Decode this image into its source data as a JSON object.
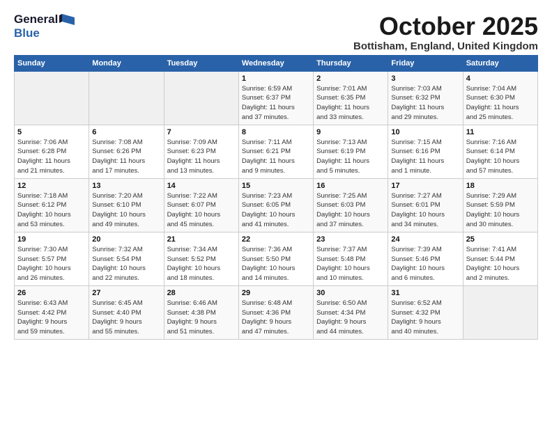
{
  "logo": {
    "general": "General",
    "blue": "Blue"
  },
  "title": "October 2025",
  "location": "Bottisham, England, United Kingdom",
  "weekdays": [
    "Sunday",
    "Monday",
    "Tuesday",
    "Wednesday",
    "Thursday",
    "Friday",
    "Saturday"
  ],
  "weeks": [
    [
      {
        "day": "",
        "info": ""
      },
      {
        "day": "",
        "info": ""
      },
      {
        "day": "",
        "info": ""
      },
      {
        "day": "1",
        "info": "Sunrise: 6:59 AM\nSunset: 6:37 PM\nDaylight: 11 hours\nand 37 minutes."
      },
      {
        "day": "2",
        "info": "Sunrise: 7:01 AM\nSunset: 6:35 PM\nDaylight: 11 hours\nand 33 minutes."
      },
      {
        "day": "3",
        "info": "Sunrise: 7:03 AM\nSunset: 6:32 PM\nDaylight: 11 hours\nand 29 minutes."
      },
      {
        "day": "4",
        "info": "Sunrise: 7:04 AM\nSunset: 6:30 PM\nDaylight: 11 hours\nand 25 minutes."
      }
    ],
    [
      {
        "day": "5",
        "info": "Sunrise: 7:06 AM\nSunset: 6:28 PM\nDaylight: 11 hours\nand 21 minutes."
      },
      {
        "day": "6",
        "info": "Sunrise: 7:08 AM\nSunset: 6:26 PM\nDaylight: 11 hours\nand 17 minutes."
      },
      {
        "day": "7",
        "info": "Sunrise: 7:09 AM\nSunset: 6:23 PM\nDaylight: 11 hours\nand 13 minutes."
      },
      {
        "day": "8",
        "info": "Sunrise: 7:11 AM\nSunset: 6:21 PM\nDaylight: 11 hours\nand 9 minutes."
      },
      {
        "day": "9",
        "info": "Sunrise: 7:13 AM\nSunset: 6:19 PM\nDaylight: 11 hours\nand 5 minutes."
      },
      {
        "day": "10",
        "info": "Sunrise: 7:15 AM\nSunset: 6:16 PM\nDaylight: 11 hours\nand 1 minute."
      },
      {
        "day": "11",
        "info": "Sunrise: 7:16 AM\nSunset: 6:14 PM\nDaylight: 10 hours\nand 57 minutes."
      }
    ],
    [
      {
        "day": "12",
        "info": "Sunrise: 7:18 AM\nSunset: 6:12 PM\nDaylight: 10 hours\nand 53 minutes."
      },
      {
        "day": "13",
        "info": "Sunrise: 7:20 AM\nSunset: 6:10 PM\nDaylight: 10 hours\nand 49 minutes."
      },
      {
        "day": "14",
        "info": "Sunrise: 7:22 AM\nSunset: 6:07 PM\nDaylight: 10 hours\nand 45 minutes."
      },
      {
        "day": "15",
        "info": "Sunrise: 7:23 AM\nSunset: 6:05 PM\nDaylight: 10 hours\nand 41 minutes."
      },
      {
        "day": "16",
        "info": "Sunrise: 7:25 AM\nSunset: 6:03 PM\nDaylight: 10 hours\nand 37 minutes."
      },
      {
        "day": "17",
        "info": "Sunrise: 7:27 AM\nSunset: 6:01 PM\nDaylight: 10 hours\nand 34 minutes."
      },
      {
        "day": "18",
        "info": "Sunrise: 7:29 AM\nSunset: 5:59 PM\nDaylight: 10 hours\nand 30 minutes."
      }
    ],
    [
      {
        "day": "19",
        "info": "Sunrise: 7:30 AM\nSunset: 5:57 PM\nDaylight: 10 hours\nand 26 minutes."
      },
      {
        "day": "20",
        "info": "Sunrise: 7:32 AM\nSunset: 5:54 PM\nDaylight: 10 hours\nand 22 minutes."
      },
      {
        "day": "21",
        "info": "Sunrise: 7:34 AM\nSunset: 5:52 PM\nDaylight: 10 hours\nand 18 minutes."
      },
      {
        "day": "22",
        "info": "Sunrise: 7:36 AM\nSunset: 5:50 PM\nDaylight: 10 hours\nand 14 minutes."
      },
      {
        "day": "23",
        "info": "Sunrise: 7:37 AM\nSunset: 5:48 PM\nDaylight: 10 hours\nand 10 minutes."
      },
      {
        "day": "24",
        "info": "Sunrise: 7:39 AM\nSunset: 5:46 PM\nDaylight: 10 hours\nand 6 minutes."
      },
      {
        "day": "25",
        "info": "Sunrise: 7:41 AM\nSunset: 5:44 PM\nDaylight: 10 hours\nand 2 minutes."
      }
    ],
    [
      {
        "day": "26",
        "info": "Sunrise: 6:43 AM\nSunset: 4:42 PM\nDaylight: 9 hours\nand 59 minutes."
      },
      {
        "day": "27",
        "info": "Sunrise: 6:45 AM\nSunset: 4:40 PM\nDaylight: 9 hours\nand 55 minutes."
      },
      {
        "day": "28",
        "info": "Sunrise: 6:46 AM\nSunset: 4:38 PM\nDaylight: 9 hours\nand 51 minutes."
      },
      {
        "day": "29",
        "info": "Sunrise: 6:48 AM\nSunset: 4:36 PM\nDaylight: 9 hours\nand 47 minutes."
      },
      {
        "day": "30",
        "info": "Sunrise: 6:50 AM\nSunset: 4:34 PM\nDaylight: 9 hours\nand 44 minutes."
      },
      {
        "day": "31",
        "info": "Sunrise: 6:52 AM\nSunset: 4:32 PM\nDaylight: 9 hours\nand 40 minutes."
      },
      {
        "day": "",
        "info": ""
      }
    ]
  ]
}
